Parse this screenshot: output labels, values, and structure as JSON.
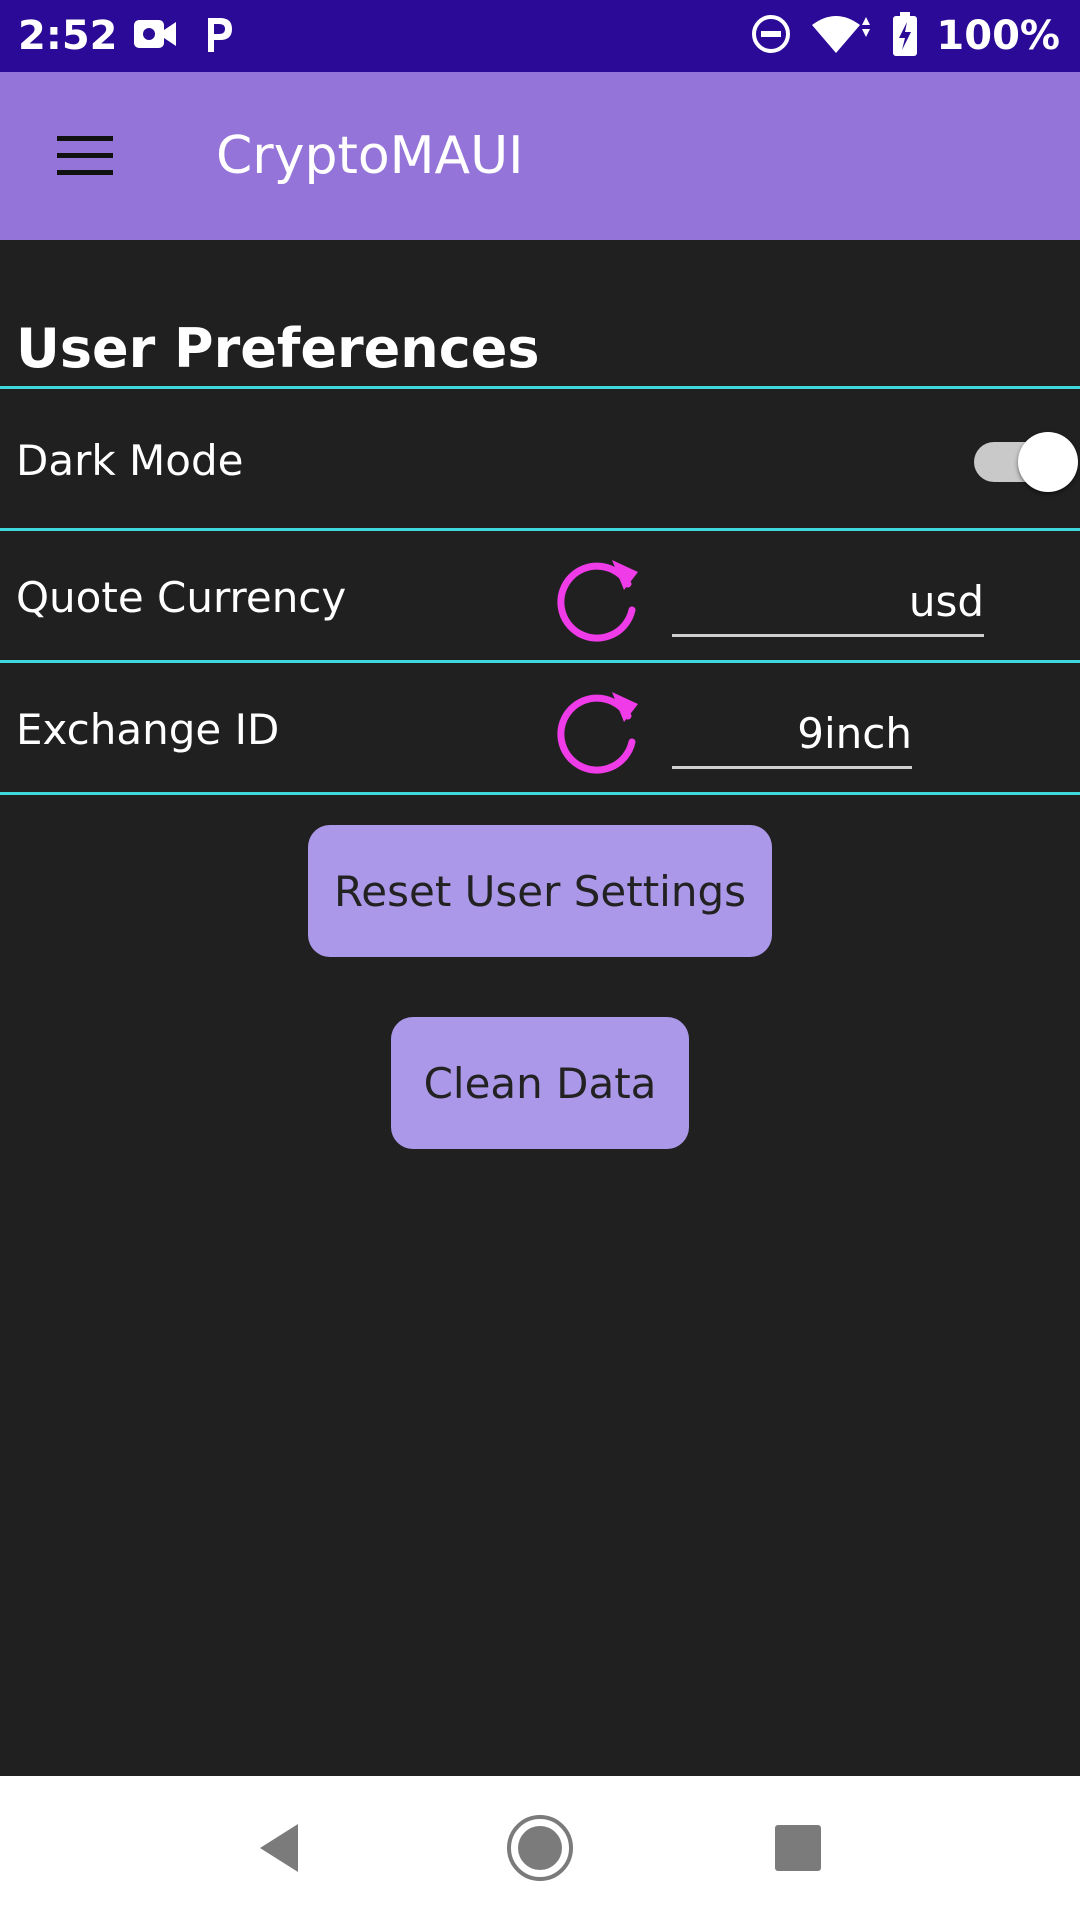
{
  "status_bar": {
    "time": "2:52",
    "battery": "100%",
    "icons_left": [
      "video-camera-icon",
      "parking-icon"
    ],
    "icons_right": [
      "do-not-disturb-icon",
      "wifi-icon",
      "battery-charging-icon"
    ]
  },
  "app_bar": {
    "title": "CryptoMAUI",
    "menu_icon": "hamburger-menu-icon"
  },
  "preferences": {
    "section_title": "User Preferences",
    "dark_mode": {
      "label": "Dark Mode",
      "enabled": true
    },
    "quote_currency": {
      "label": "Quote Currency",
      "value": "usd",
      "refresh_icon": "refresh-icon"
    },
    "exchange_id": {
      "label": "Exchange ID",
      "value": "9inch",
      "refresh_icon": "refresh-icon"
    }
  },
  "actions": {
    "reset_label": "Reset User Settings",
    "clean_label": "Clean Data"
  },
  "nav_bar": {
    "icons": [
      "back-icon",
      "home-icon",
      "recents-icon"
    ]
  },
  "colors": {
    "status_bar": "#2a0a96",
    "app_bar": "#9474d8",
    "background": "#202020",
    "divider": "#3fd8dc",
    "button": "#ac98e8",
    "refresh_icon": "#f03ce8"
  }
}
